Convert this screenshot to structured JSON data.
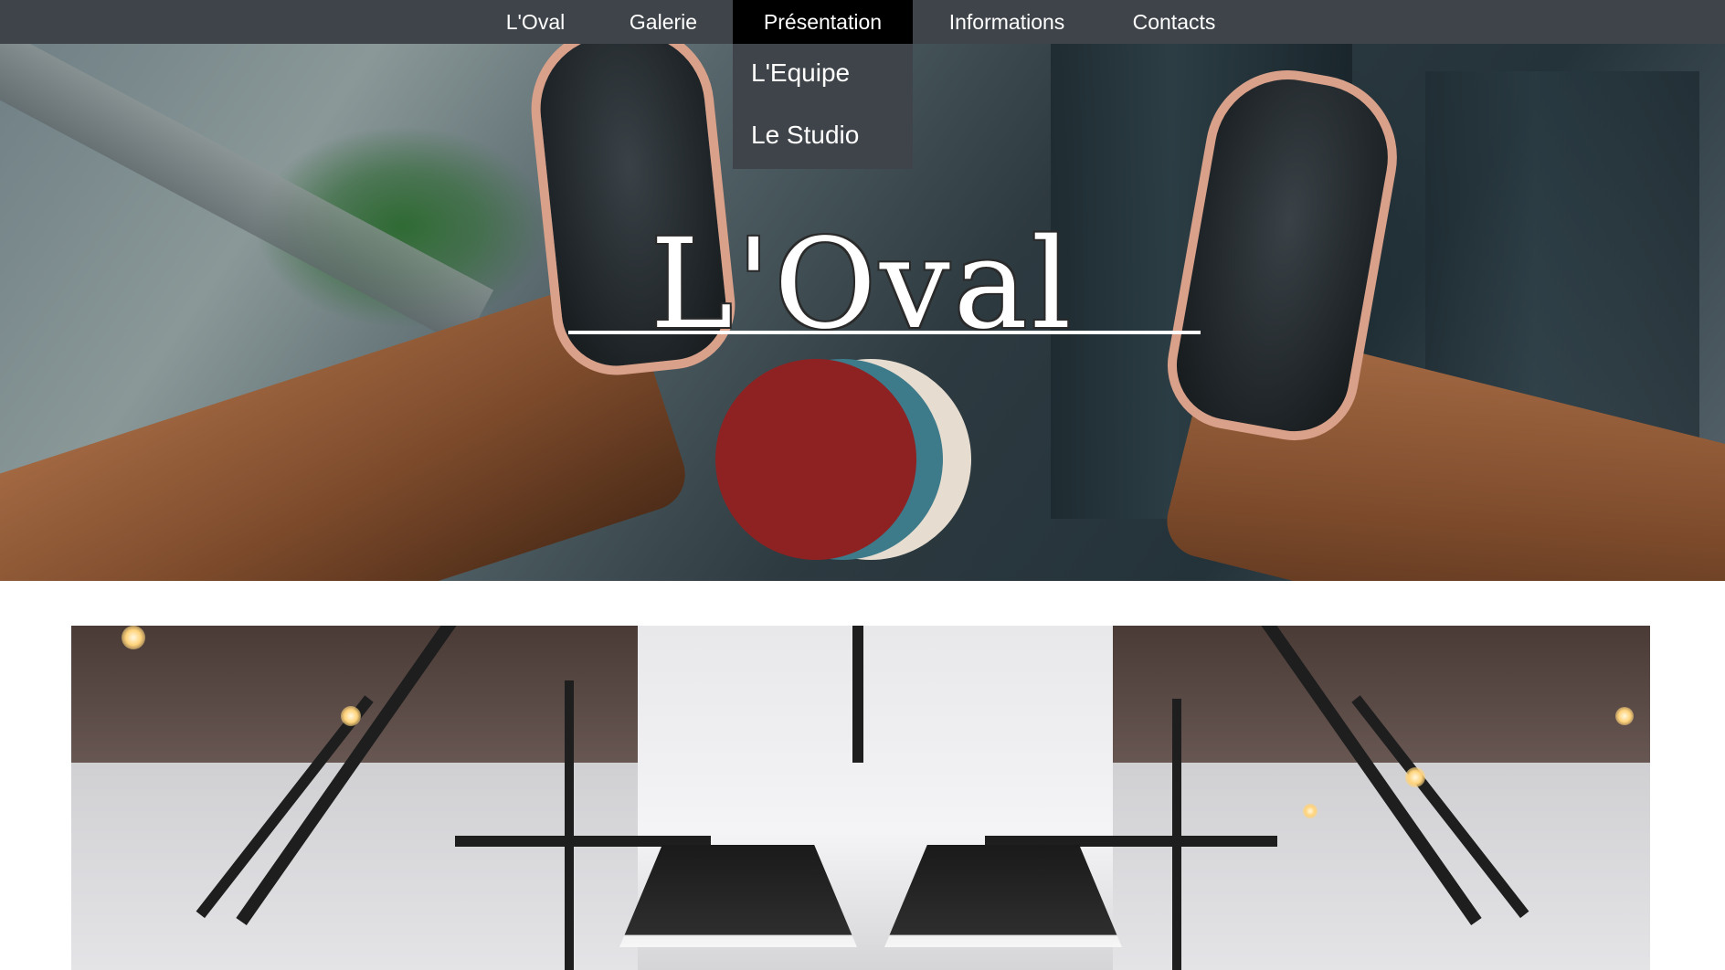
{
  "nav": {
    "items": [
      {
        "label": "L'Oval"
      },
      {
        "label": "Galerie"
      },
      {
        "label": "Présentation",
        "active": true
      },
      {
        "label": "Informations"
      },
      {
        "label": "Contacts"
      }
    ],
    "dropdown": [
      {
        "label": "L'Equipe"
      },
      {
        "label": "Le Studio"
      }
    ]
  },
  "hero": {
    "title": "L'Oval",
    "logo_colors": [
      "#8e2222",
      "#3d7a8a",
      "#e6dccf"
    ]
  },
  "colors": {
    "nav_bg": "#3e4449",
    "nav_active": "#000000",
    "text": "#ffffff"
  }
}
